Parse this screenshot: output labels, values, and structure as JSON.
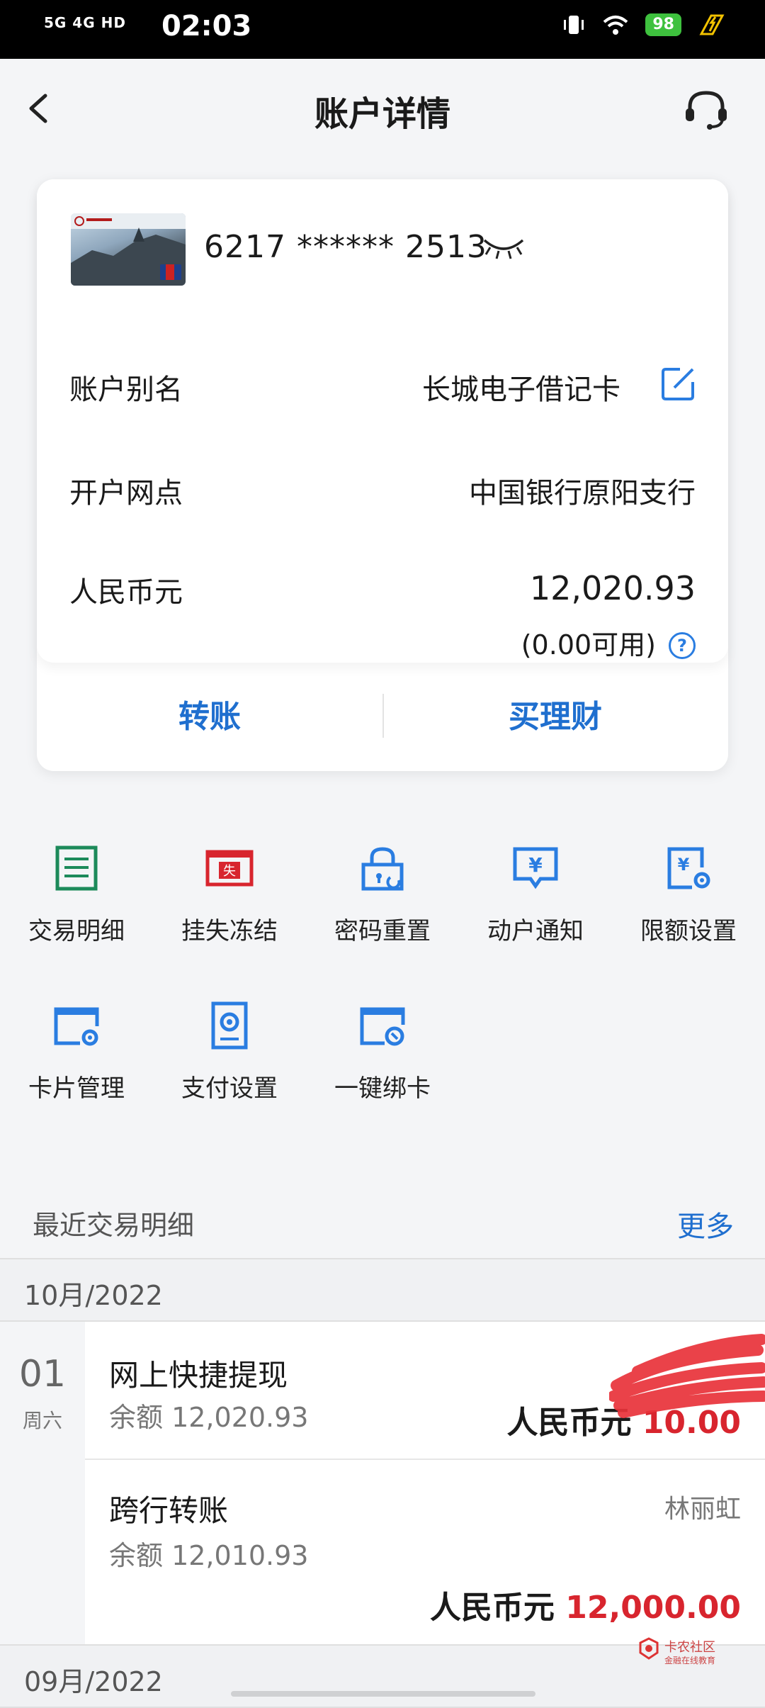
{
  "status_bar": {
    "network": "5G 4G HD",
    "time": "02:03",
    "battery": "98"
  },
  "header": {
    "title": "账户详情"
  },
  "account": {
    "card_number": "6217 ****** 2513",
    "alias_label": "账户别名",
    "alias_value": "长城电子借记卡",
    "branch_label": "开户网点",
    "branch_value": "中国银行原阳支行",
    "currency_label": "人民币元",
    "balance": "12,020.93",
    "available": "(0.00可用)",
    "help_glyph": "?"
  },
  "actions": {
    "transfer": "转账",
    "buy_finance": "买理财"
  },
  "services": [
    {
      "label": "交易明细",
      "icon": "list-icon",
      "color": "#1c8a5a"
    },
    {
      "label": "挂失冻结",
      "icon": "lost-card-icon",
      "color": "#d8252e"
    },
    {
      "label": "密码重置",
      "icon": "lock-reset-icon",
      "color": "#2a7de1"
    },
    {
      "label": "动户通知",
      "icon": "yuan-message-icon",
      "color": "#2a7de1"
    },
    {
      "label": "限额设置",
      "icon": "limit-settings-icon",
      "color": "#2a7de1"
    },
    {
      "label": "卡片管理",
      "icon": "card-settings-icon",
      "color": "#2a7de1"
    },
    {
      "label": "支付设置",
      "icon": "payment-settings-icon",
      "color": "#2a7de1"
    },
    {
      "label": "一键绑卡",
      "icon": "bind-card-icon",
      "color": "#2a7de1"
    }
  ],
  "service_icon_text": {
    "lost": "失",
    "yuan": "¥"
  },
  "recent": {
    "title": "最近交易明细",
    "more": "更多",
    "months": [
      "10月/2022",
      "09月/2022"
    ],
    "day": "01",
    "weekday": "周六",
    "transactions": [
      {
        "name": "网上快捷提现",
        "balance": "余额 12,020.93",
        "counterparty": "",
        "currency": "人民币元",
        "amount": "10.00"
      },
      {
        "name": "跨行转账",
        "balance": "余额 12,010.93",
        "counterparty": "林丽虹",
        "currency": "人民币元",
        "amount": "12,000.00"
      }
    ]
  },
  "watermark": {
    "title": "卡农社区",
    "subtitle": "金融在线教育"
  }
}
